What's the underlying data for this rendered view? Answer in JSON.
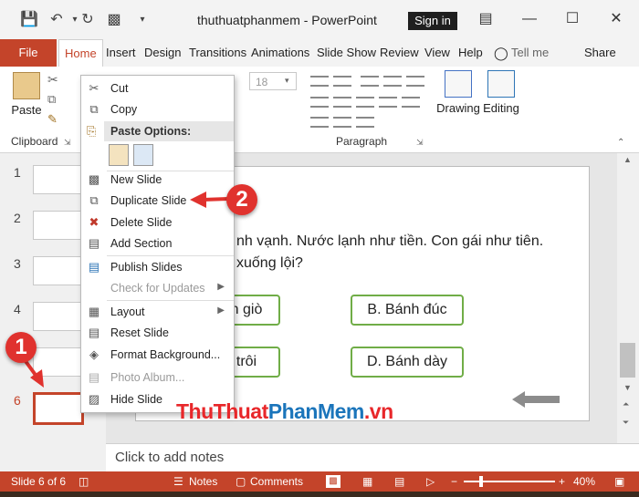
{
  "titlebar": {
    "doc_title": "thuthuatphanmem - PowerPoint",
    "signin_label": "Sign in"
  },
  "tabs": {
    "file": "File",
    "items": [
      "Home",
      "Insert",
      "Design",
      "Transitions",
      "Animations",
      "Slide Show",
      "Review",
      "View",
      "Help"
    ],
    "tell_me": "Tell me",
    "share": "Share"
  },
  "ribbon": {
    "paste_label": "Paste",
    "clipboard_label": "Clipboard",
    "font_size": "18",
    "paragraph_label": "Paragraph",
    "drawing_label": "Drawing",
    "editing_label": "Editing"
  },
  "thumbnails": {
    "numbers": [
      "1",
      "2",
      "3",
      "4",
      "5",
      "6"
    ],
    "selected": "6"
  },
  "slide": {
    "question_line1": "nh vạnh. Nước lạnh như tiền. Con gái như tiên.",
    "question_line2": "xuống lội?",
    "answers": [
      "n giò",
      "B. Bánh đúc",
      "trôi",
      "D. Bánh dày"
    ]
  },
  "notes_placeholder": "Click to add notes",
  "statusbar": {
    "slide_info": "Slide 6 of 6",
    "notes": "Notes",
    "comments": "Comments",
    "zoom": "40%"
  },
  "context_menu": {
    "cut": "Cut",
    "copy": "Copy",
    "paste_options": "Paste Options:",
    "new_slide": "New Slide",
    "duplicate_slide": "Duplicate Slide",
    "delete_slide": "Delete Slide",
    "add_section": "Add Section",
    "publish_slides": "Publish Slides",
    "check_updates": "Check for Updates",
    "layout": "Layout",
    "reset_slide": "Reset Slide",
    "format_background": "Format Background...",
    "photo_album": "Photo Album...",
    "hide_slide": "Hide Slide"
  },
  "annotations": {
    "step1": "1",
    "step2": "2"
  },
  "watermark": {
    "part1": "ThuThuat",
    "part2": "PhanMem",
    "part3": ".vn"
  },
  "colors": {
    "accent": "#c4442a",
    "answer_border": "#70ad47",
    "badge": "#e0322e"
  }
}
